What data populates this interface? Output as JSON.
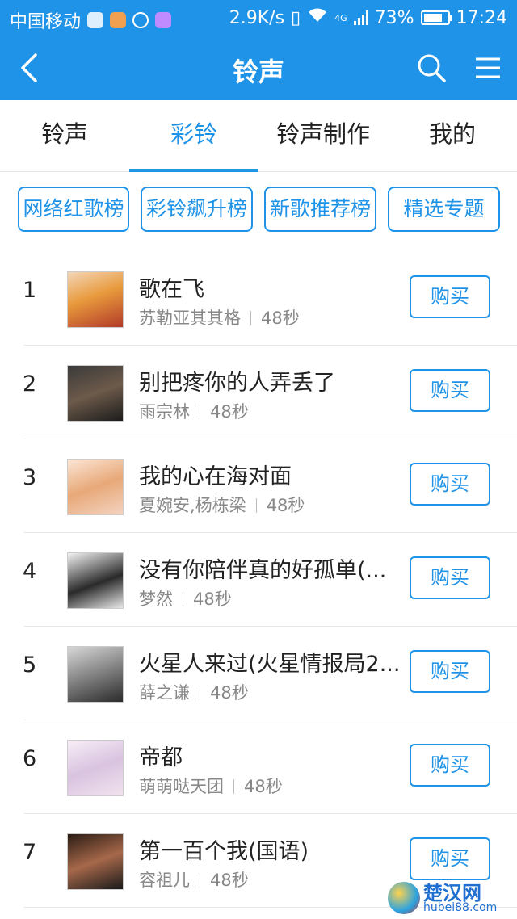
{
  "statusbar": {
    "carrier": "中国移动",
    "speed": "2.9K/s",
    "network": "4G",
    "battery": "73%",
    "time": "17:24"
  },
  "appbar": {
    "title": "铃声"
  },
  "tabs": [
    {
      "label": "铃声",
      "active": false
    },
    {
      "label": "彩铃",
      "active": true
    },
    {
      "label": "铃声制作",
      "active": false
    },
    {
      "label": "我的",
      "active": false
    }
  ],
  "chips": [
    {
      "label": "网络红歌榜"
    },
    {
      "label": "彩铃飙升榜"
    },
    {
      "label": "新歌推荐榜"
    },
    {
      "label": "精选专题"
    }
  ],
  "songs": [
    {
      "rank": "1",
      "title": "歌在飞",
      "artist": "苏勒亚其其格",
      "duration": "48秒",
      "buy": "购买"
    },
    {
      "rank": "2",
      "title": "别把疼你的人弄丢了",
      "artist": "雨宗林",
      "duration": "48秒",
      "buy": "购买"
    },
    {
      "rank": "3",
      "title": "我的心在海对面",
      "artist": "夏婉安,杨栋梁",
      "duration": "48秒",
      "buy": "购买"
    },
    {
      "rank": "4",
      "title": "没有你陪伴真的好孤单(...",
      "artist": "梦然",
      "duration": "48秒",
      "buy": "购买"
    },
    {
      "rank": "5",
      "title": "火星人来过(火星情报局2...",
      "artist": "薛之谦",
      "duration": "48秒",
      "buy": "购买"
    },
    {
      "rank": "6",
      "title": "帝都",
      "artist": "萌萌哒天团",
      "duration": "48秒",
      "buy": "购买"
    },
    {
      "rank": "7",
      "title": "第一百个我(国语)",
      "artist": "容祖儿",
      "duration": "48秒",
      "buy": "购买"
    }
  ],
  "watermark": {
    "name": "楚汉网",
    "url": "hubei88.com"
  },
  "colors": {
    "accent": "#1f93e8"
  }
}
